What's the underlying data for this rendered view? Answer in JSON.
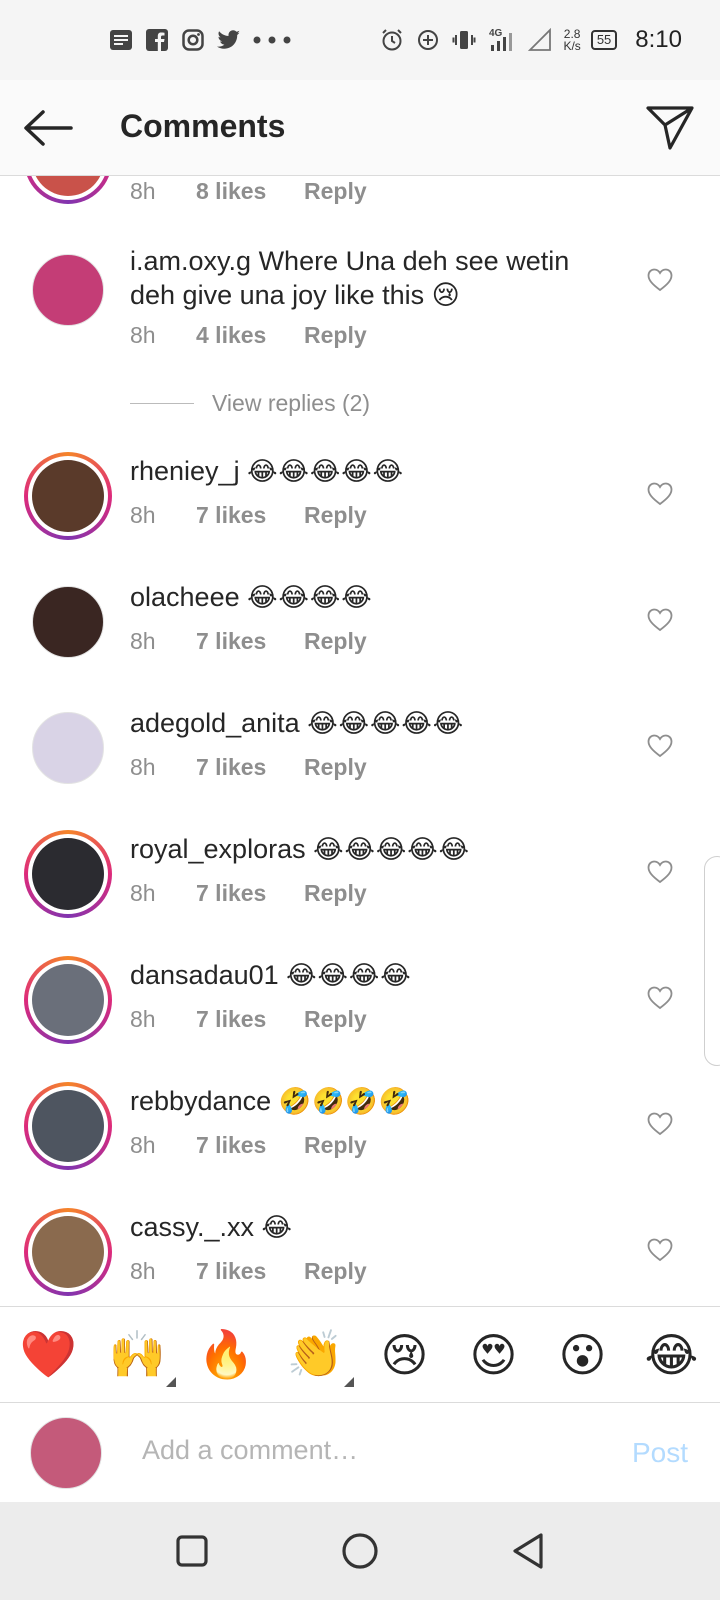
{
  "status_bar": {
    "left_icons": [
      "notes-icon",
      "facebook-icon",
      "instagram-icon",
      "twitter-icon",
      "more-dots-icon"
    ],
    "speed_value": "2.8",
    "speed_unit": "K/s",
    "battery": "55",
    "network": "4G",
    "time": "8:10"
  },
  "header": {
    "title": "Comments"
  },
  "partial_comment": {
    "time": "8h",
    "likes": "8 likes",
    "reply": "Reply"
  },
  "comments": [
    {
      "username": "i.am.oxy.g",
      "text": "Where Una deh see wetin deh give una joy like this 😢",
      "time": "8h",
      "likes": "4 likes",
      "reply": "Reply",
      "story_ring": false,
      "avatar_color": "#c43d76"
    },
    {
      "username": "rheniey_j",
      "text": "😂😂😂😂😂",
      "time": "8h",
      "likes": "7 likes",
      "reply": "Reply",
      "story_ring": true,
      "avatar_color": "#5a3a2a"
    },
    {
      "username": "olacheee",
      "text": "😂😂😂😂",
      "time": "8h",
      "likes": "7 likes",
      "reply": "Reply",
      "story_ring": false,
      "avatar_color": "#3a2622"
    },
    {
      "username": "adegold_anita",
      "text": "😂😂😂😂😂",
      "time": "8h",
      "likes": "7 likes",
      "reply": "Reply",
      "story_ring": false,
      "avatar_color": "#d9d3e6"
    },
    {
      "username": "royal_exploras",
      "text": "😂😂😂😂😂",
      "time": "8h",
      "likes": "7 likes",
      "reply": "Reply",
      "story_ring": true,
      "avatar_color": "#2b2b30"
    },
    {
      "username": "dansadau01",
      "text": "😂😂😂😂",
      "time": "8h",
      "likes": "7 likes",
      "reply": "Reply",
      "story_ring": true,
      "avatar_color": "#6a6f7a"
    },
    {
      "username": "rebbydance",
      "text": "🤣🤣🤣🤣",
      "time": "8h",
      "likes": "7 likes",
      "reply": "Reply",
      "story_ring": true,
      "avatar_color": "#4e5560"
    },
    {
      "username": "cassy._.xx",
      "text": "😂",
      "time": "8h",
      "likes": "7 likes",
      "reply": "Reply",
      "story_ring": true,
      "avatar_color": "#8a6a4e"
    }
  ],
  "view_replies": "View replies (2)",
  "emoji_bar": [
    "❤️",
    "🙌",
    "🔥",
    "👏",
    "😢",
    "😍",
    "😮",
    "😂"
  ],
  "composer": {
    "placeholder": "Add a comment…",
    "post_label": "Post",
    "avatar_color": "#c45a7a"
  },
  "colors": {
    "accent_post": "#b3dbff",
    "meta_gray": "#8e8e8e",
    "like_heart": "#e0245e"
  }
}
